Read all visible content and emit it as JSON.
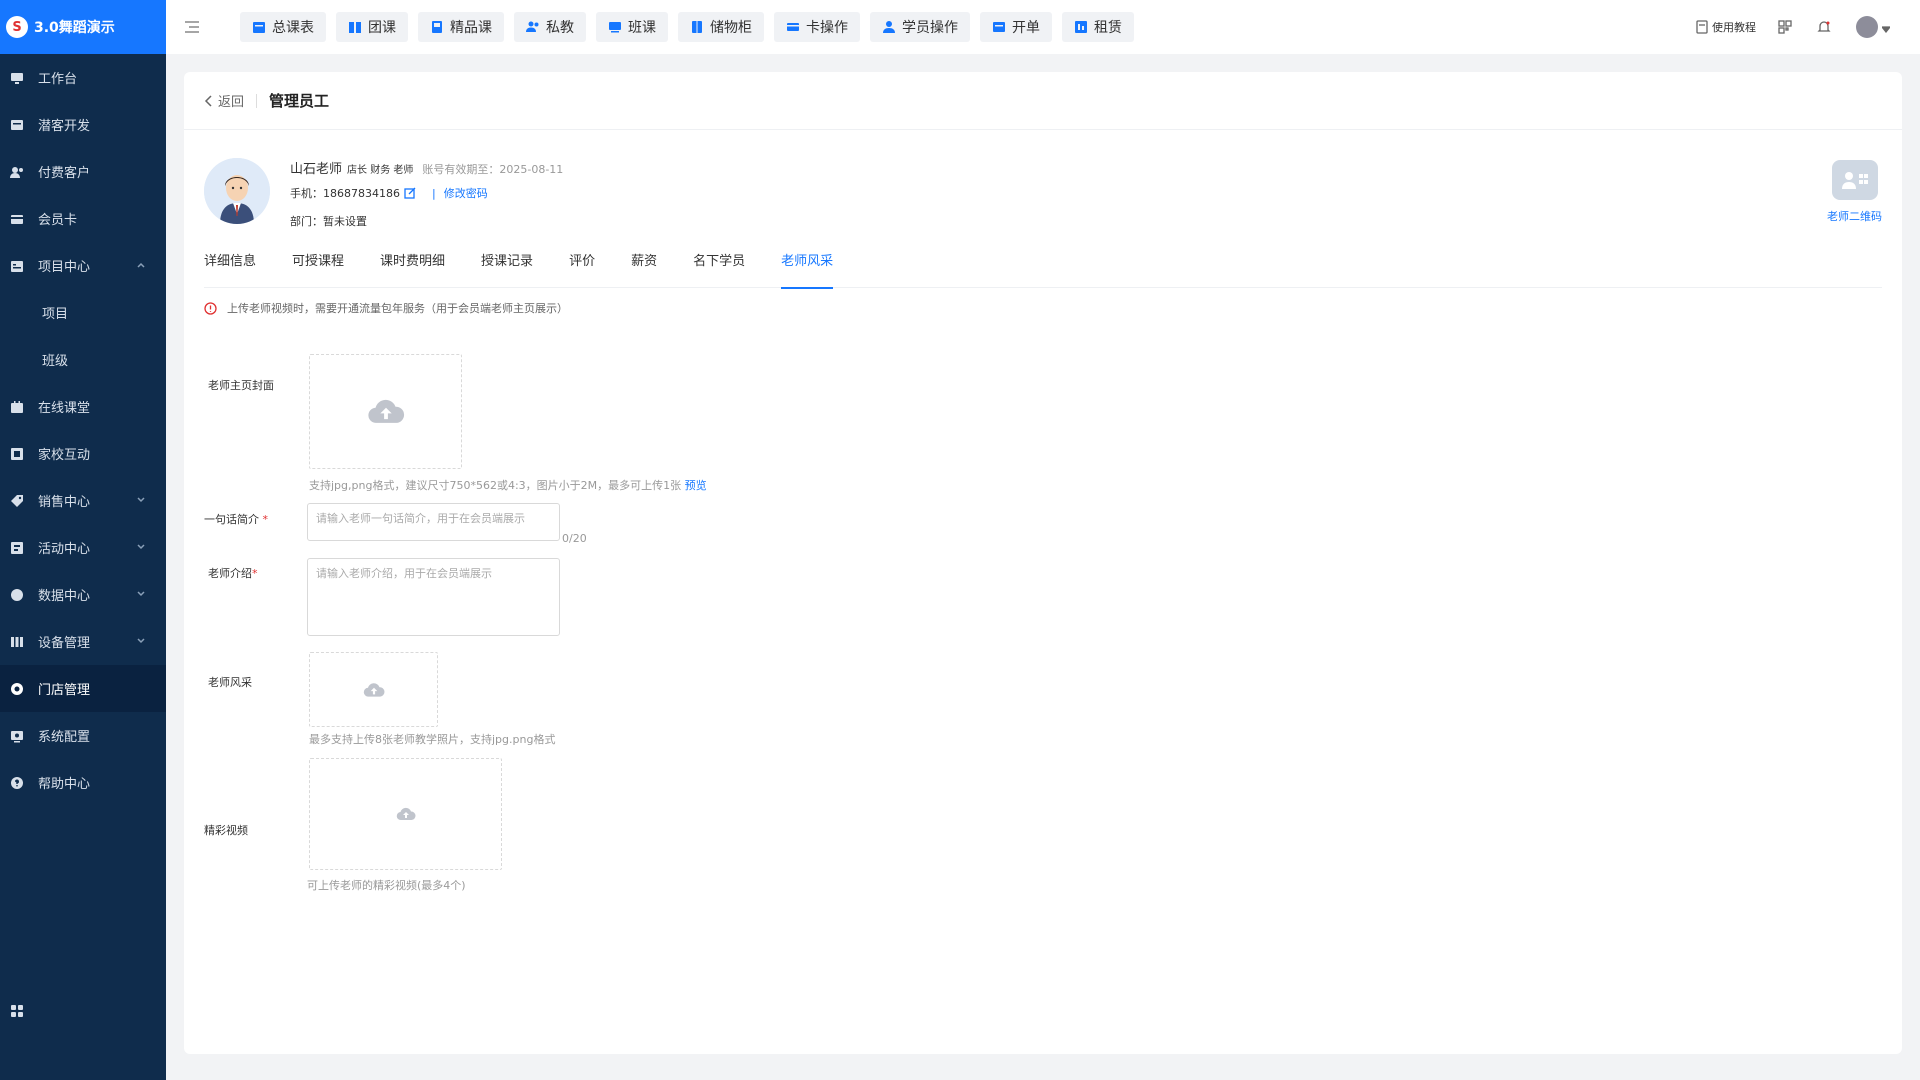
{
  "app": {
    "name": "3.0舞蹈演示"
  },
  "sidebar": {
    "items": [
      {
        "label": "工作台",
        "icon": "desktop-icon"
      },
      {
        "label": "潜客开发",
        "icon": "prospect-icon"
      },
      {
        "label": "付费客户",
        "icon": "customers-icon"
      },
      {
        "label": "会员卡",
        "icon": "card-icon"
      },
      {
        "label": "项目中心",
        "icon": "folder-icon"
      },
      {
        "label": "项目"
      },
      {
        "label": "班级"
      },
      {
        "label": "在线课堂",
        "icon": "classroom-icon"
      },
      {
        "label": "家校互动",
        "icon": "interaction-icon"
      },
      {
        "label": "销售中心",
        "icon": "tag-icon"
      },
      {
        "label": "活动中心",
        "icon": "activity-icon"
      },
      {
        "label": "数据中心",
        "icon": "chart-icon"
      },
      {
        "label": "设备管理",
        "icon": "device-icon"
      },
      {
        "label": "门店管理",
        "icon": "store-icon"
      },
      {
        "label": "系统配置",
        "icon": "settings-icon"
      },
      {
        "label": "帮助中心",
        "icon": "help-icon"
      }
    ]
  },
  "topbar": {
    "quick": [
      "总课表",
      "团课",
      "精品课",
      "私教",
      "班课",
      "储物柜",
      "卡操作",
      "学员操作",
      "开单",
      "租赁"
    ],
    "tutorial": "使用教程"
  },
  "page": {
    "back": "返回",
    "title": "管理员工"
  },
  "profile": {
    "name": "山石老师",
    "roles": "店长 财务 老师",
    "valid_until": "账号有效期至：2025-08-11",
    "phone_label": "手机：",
    "phone": "18687834186",
    "change_password": "修改密码",
    "dept_label": "部门：",
    "dept": "暂未设置",
    "qr_label": "老师二维码"
  },
  "tabs": [
    "详细信息",
    "可授课程",
    "课时费明细",
    "授课记录",
    "评价",
    "薪资",
    "名下学员",
    "老师风采"
  ],
  "active_tab": "老师风采",
  "notice": "上传老师视频时，需要开通流量包年服务（用于会员端老师主页展示）",
  "form": {
    "cover_label": "老师主页封面",
    "cover_hint": "支持jpg,png格式，建议尺寸750*562或4:3，图片小于2M，最多可上传1张",
    "cover_preview": "预览",
    "intro_label": "一句话简介",
    "intro_placeholder": "请输入老师一句话简介，用于在会员端展示",
    "intro_count": "0/20",
    "desc_label": "老师介绍",
    "desc_placeholder": "请输入老师介绍，用于在会员端展示",
    "style_label": "老师风采",
    "style_hint": "最多支持上传8张老师教学照片，支持jpg.png格式",
    "video_label": "精彩视频",
    "video_hint": "可上传老师的精彩视频(最多4个)"
  }
}
